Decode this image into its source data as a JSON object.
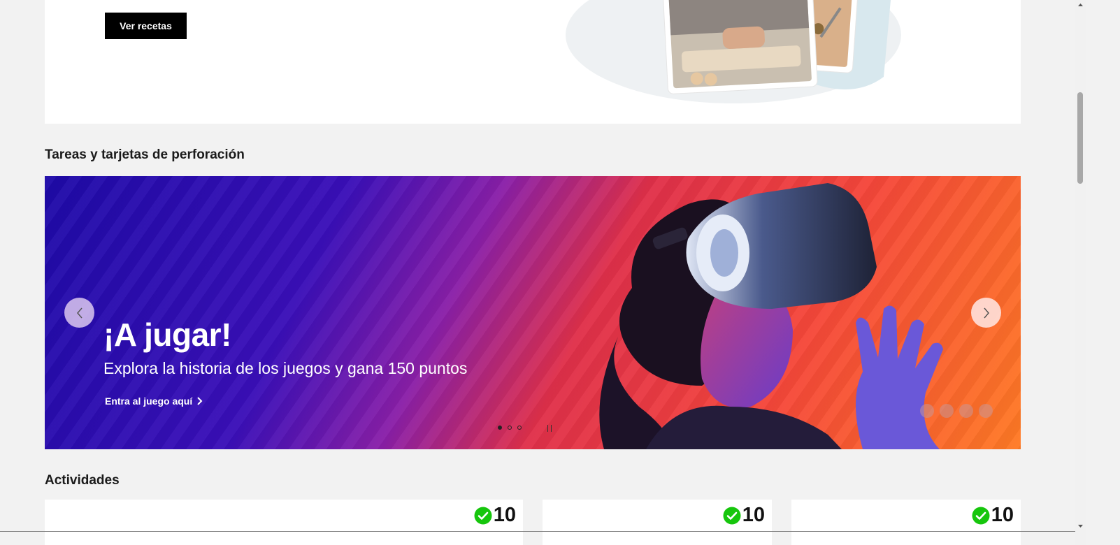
{
  "recipe": {
    "button_label": "Ver recetas"
  },
  "sections": {
    "tasks_title": "Tareas y tarjetas de perforación",
    "activities_title": "Actividades"
  },
  "carousel": {
    "title": "¡A jugar!",
    "subtitle": "Explora la historia de los juegos y gana 150 puntos",
    "link_label": "Entra al juego aquí",
    "slide_count": 3,
    "active_slide": 1
  },
  "activities": [
    {
      "points": "10",
      "status": "completed"
    },
    {
      "points": "10",
      "status": "completed"
    },
    {
      "points": "10",
      "status": "completed"
    }
  ],
  "colors": {
    "accent_check": "#16c60c",
    "button_bg": "#000000"
  },
  "icons": [
    "chevron-left-icon",
    "chevron-right-icon",
    "check-circle-icon",
    "pause-icon"
  ]
}
